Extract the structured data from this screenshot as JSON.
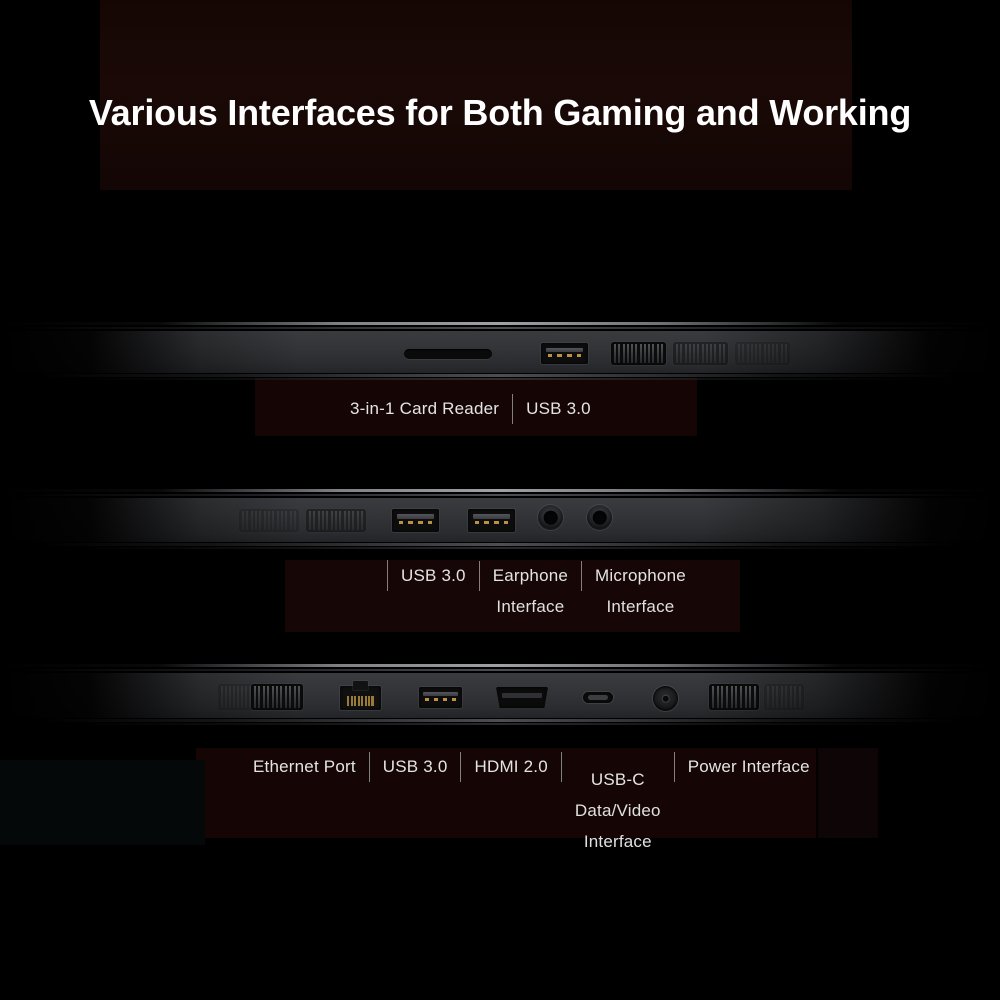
{
  "page": {
    "title": "Various Interfaces for Both Gaming and Working",
    "background_color": "#000000",
    "accent_panel_color": "#1a0907",
    "text_color": "#e4e4e4"
  },
  "rows": [
    {
      "id": "right-side",
      "ports": [
        {
          "name": "card-reader-slot",
          "type": "card-reader"
        },
        {
          "name": "usb-a-port",
          "type": "usb-a"
        },
        {
          "name": "vent-grille",
          "type": "vent"
        },
        {
          "name": "vent-grille",
          "type": "vent"
        },
        {
          "name": "vent-grille",
          "type": "vent"
        }
      ],
      "labels": [
        {
          "lines": [
            "3-in-1 Card Reader"
          ]
        },
        {
          "lines": [
            "USB 3.0"
          ]
        }
      ]
    },
    {
      "id": "left-side",
      "ports": [
        {
          "name": "vent-grille",
          "type": "vent"
        },
        {
          "name": "vent-grille",
          "type": "vent"
        },
        {
          "name": "usb-a-port",
          "type": "usb-a"
        },
        {
          "name": "usb-a-port",
          "type": "usb-a"
        },
        {
          "name": "earphone-jack",
          "type": "audio"
        },
        {
          "name": "microphone-jack",
          "type": "audio"
        }
      ],
      "labels": [
        {
          "lines": [
            "USB 3.0"
          ]
        },
        {
          "lines": [
            "Earphone",
            "Interface"
          ]
        },
        {
          "lines": [
            "Microphone",
            "Interface"
          ]
        }
      ]
    },
    {
      "id": "rear-side",
      "ports": [
        {
          "name": "vent-grille",
          "type": "vent"
        },
        {
          "name": "vent-grille",
          "type": "vent"
        },
        {
          "name": "ethernet-port",
          "type": "ethernet"
        },
        {
          "name": "usb-a-port",
          "type": "usb-a"
        },
        {
          "name": "hdmi-port",
          "type": "hdmi"
        },
        {
          "name": "usb-c-port",
          "type": "usb-c"
        },
        {
          "name": "power-jack",
          "type": "power"
        },
        {
          "name": "vent-grille",
          "type": "vent"
        },
        {
          "name": "vent-grille",
          "type": "vent"
        }
      ],
      "labels": [
        {
          "lines": [
            "Ethernet Port"
          ]
        },
        {
          "lines": [
            "USB 3.0"
          ]
        },
        {
          "lines": [
            "HDMI 2.0"
          ]
        },
        {
          "lines": [
            "USB-C",
            "Data/Video",
            "Interface"
          ]
        },
        {
          "lines": [
            "Power Interface"
          ]
        }
      ]
    }
  ]
}
